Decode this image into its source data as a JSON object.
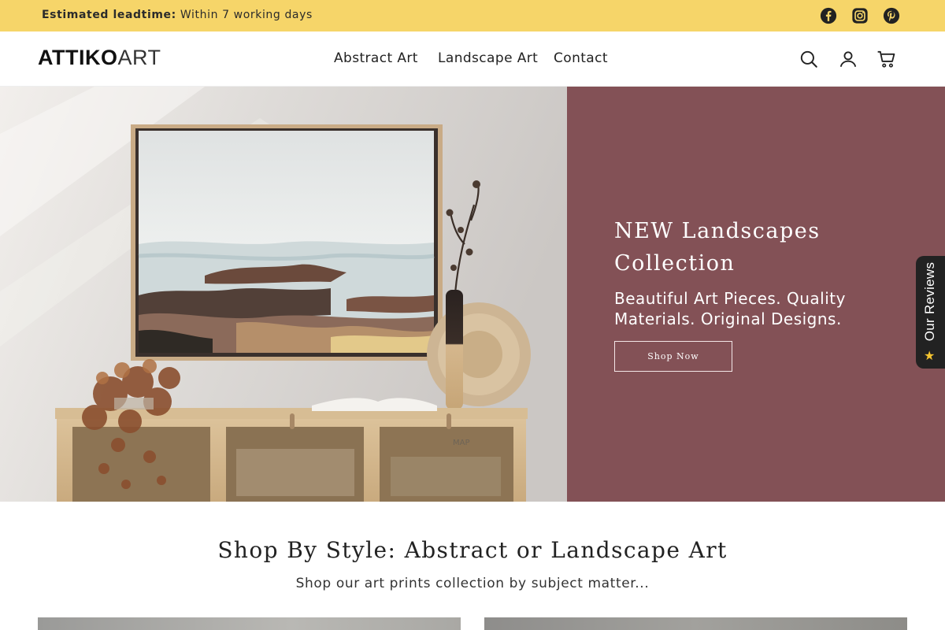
{
  "announcement": {
    "label": "Estimated leadtime:",
    "value": "Within 7 working days",
    "background": "#f6d569"
  },
  "social_icons": [
    "facebook-icon",
    "instagram-icon",
    "pinterest-icon"
  ],
  "header": {
    "logo_primary": "ATTIKO",
    "logo_secondary": "ART",
    "nav": [
      "Abstract Art",
      "Landscape Art",
      "Contact"
    ],
    "icons": [
      "search-icon",
      "account-icon",
      "cart-icon"
    ]
  },
  "hero": {
    "title": "NEW Landscapes Collection",
    "subtitle": "Beautiful Art Pieces. Quality Materials. Original Designs.",
    "button_label": "Shop Now",
    "panel_color": "#835156",
    "image_text": "MAP"
  },
  "reviews_tab": {
    "label": "Our Reviews",
    "icon": "star-icon"
  },
  "section": {
    "title": "Shop By Style: Abstract or Landscape Art",
    "subtitle": "Shop our art prints collection by subject matter..."
  }
}
